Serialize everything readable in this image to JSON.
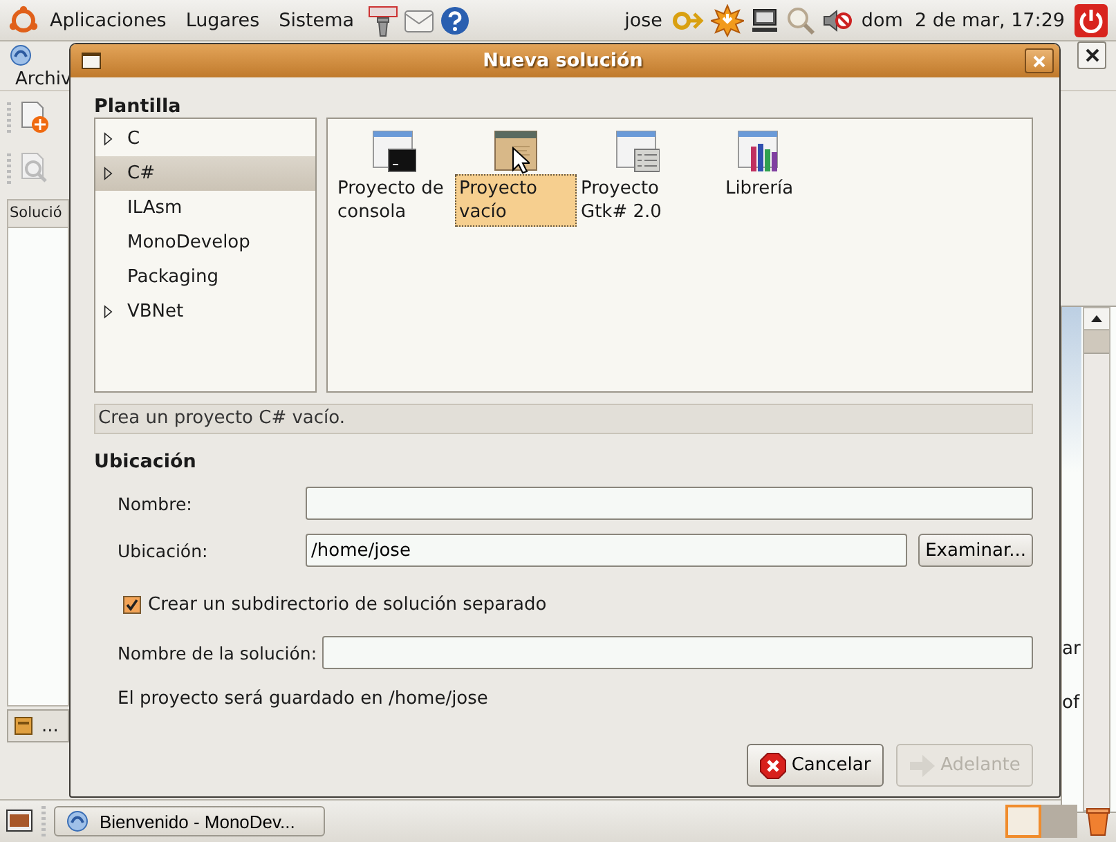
{
  "top_panel": {
    "menus": [
      "Aplicaciones",
      "Lugares",
      "Sistema"
    ],
    "user": "jose",
    "clock": "dom  2 de mar, 17:29"
  },
  "background_window": {
    "menu": "Archiv",
    "pad_title": "Solució",
    "tab_label": "...",
    "text_fragments": [
      "ar",
      "of"
    ]
  },
  "dialog": {
    "title": "Nueva solución",
    "template_heading": "Plantilla",
    "categories": [
      {
        "label": "C",
        "expanded": false,
        "selected": false
      },
      {
        "label": "C#",
        "expanded": false,
        "selected": true
      },
      {
        "label": "ILAsm",
        "selected": false
      },
      {
        "label": "MonoDevelop",
        "selected": false
      },
      {
        "label": "Packaging",
        "selected": false
      },
      {
        "label": "VBNet",
        "expanded": false,
        "selected": false
      }
    ],
    "templates": [
      {
        "label": "Proyecto de consola",
        "kind": "console",
        "selected": false
      },
      {
        "label": "Proyecto vacío",
        "kind": "empty",
        "selected": true
      },
      {
        "label": "Proyecto Gtk# 2.0",
        "kind": "gtk",
        "selected": false
      },
      {
        "label": "Librería",
        "kind": "library",
        "selected": false
      }
    ],
    "description": "Crea un proyecto C# vacío.",
    "location_heading": "Ubicación",
    "fields": [
      {
        "label": "Nombre:"
      },
      {
        "label": "Ubicación:",
        "value": "/home/jose",
        "button": "Examinar..."
      }
    ],
    "checkbox": {
      "label": "Crear un subdirectorio de solución separado",
      "checked": true
    },
    "solution_field": {
      "label": "Nombre de la solución:"
    },
    "note": "El proyecto será guardado en /home/jose",
    "buttons": [
      {
        "label": "Cancelar",
        "kind": "cancel",
        "disabled": false
      },
      {
        "label": "Adelante",
        "kind": "forward",
        "disabled": true
      }
    ]
  },
  "taskbar": {
    "tasks": [
      {
        "label": "Bienvenido - MonoDev...",
        "selected": false
      }
    ],
    "workspaces": [
      {
        "selected": true
      },
      {
        "selected": false
      }
    ]
  }
}
